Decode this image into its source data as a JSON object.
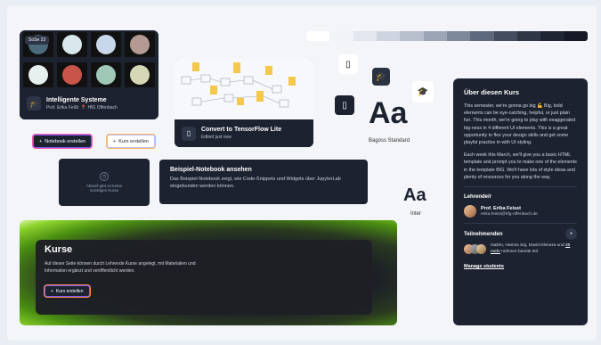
{
  "course_card": {
    "badge": "SoSe 23",
    "title": "Intelligente Systeme",
    "professor": "Prof. Erika Feißt",
    "location": "HfG Offenbach"
  },
  "buttons": {
    "notebook_create": "Notebook erstellen",
    "course_create": "Kurs erstellen"
  },
  "tf_card": {
    "title": "Convert to TensorFlow Lite",
    "subtitle": "Edited just now"
  },
  "palette": [
    "#ffffff",
    "#f1f3f7",
    "#e2e6ee",
    "#cfd5e0",
    "#b7bfcd",
    "#9ca5b6",
    "#7e889b",
    "#5f697d",
    "#444d5f",
    "#2f3646",
    "#1f2533",
    "#141925"
  ],
  "typography": {
    "sample": "Aa",
    "font1": "Bagoss Standard",
    "font2": "Inter"
  },
  "example_empty": {
    "text": "Aktuell gibt es keine sonstigen Kurse"
  },
  "example_notebook": {
    "title": "Beispiel-Notebook ansehen",
    "body": "Das Beispiel-Notebook zeigt, wie Code-Snippets und Widgets über JupyterLab eingebunden werden können."
  },
  "kurse": {
    "title": "Kurse",
    "body": "Auf dieser Seite können durch Lehrende Kurse angelegt, mit Materialien und Information ergänzt und veröffentlicht werden.",
    "button": "Kurs erstellen"
  },
  "panel": {
    "title": "Über diesen Kurs",
    "para1": "This semester, we're gonna go big 💪 Big, bold elements can be eye-catching, helpful, or just plain fun. This month, we're going to play with exaggerated big-ness in 4 different UI elements. This is a great opportunity to flex your design skills and get some playful practice in with UI styling.",
    "para2": "Each week this March, we'll give you a basic HTML template and prompt you to make one of the elements in the template BIG. We'll have lots of style ideas and plenty of resources for you along the way.",
    "teacher_heading": "Lehrende/r",
    "teacher_name": "Prof. Erika Feisst",
    "teacher_email": "erika.feisst@hfg-offenbach.de",
    "participants_heading": "Teilnehmenden",
    "participants_text_a": "IsaDm, Hamza Saj, David Klimeza und ",
    "participants_more": "35 mehr",
    "participants_text_b": " nehmen bereits teil.",
    "manage": "Manage students"
  }
}
